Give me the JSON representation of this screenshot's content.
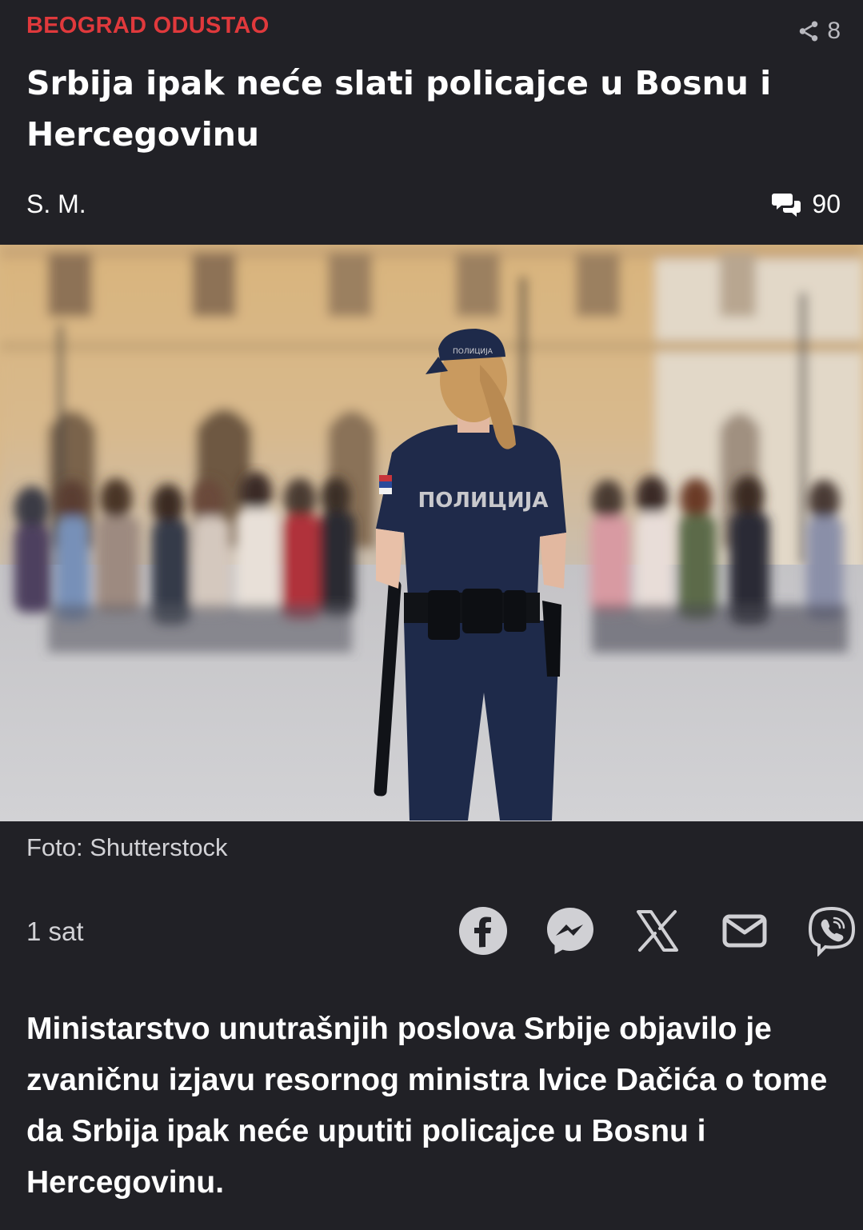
{
  "article": {
    "kicker": "BEOGRAD ODUSTAO",
    "share_count": "8",
    "headline": "Srbija ipak neće slati policajce u Bosnu i Hercegovinu",
    "author": "S. M.",
    "comment_count": "90",
    "photo_caption": "Foto: Shutterstock",
    "time_ago": "1 sat",
    "lead": "Ministarstvo unutrašnjih poslova Srbije objavilo je zvaničnu izjavu resornog ministra Ivice Dačića o tome da Srbija ipak neće uputiti policajce u Bosnu i Hercegovinu."
  },
  "photo": {
    "uniform_text": "ПОЛИЦИЈА",
    "cap_text": "ПОЛИЦИЈА"
  },
  "share_buttons": [
    {
      "icon": "facebook-icon"
    },
    {
      "icon": "messenger-icon"
    },
    {
      "icon": "x-icon"
    },
    {
      "icon": "email-icon"
    },
    {
      "icon": "viber-icon"
    }
  ],
  "colors": {
    "background": "#212126",
    "kicker": "#e0393c",
    "text": "#ffffff",
    "muted": "#d2d2d6"
  }
}
